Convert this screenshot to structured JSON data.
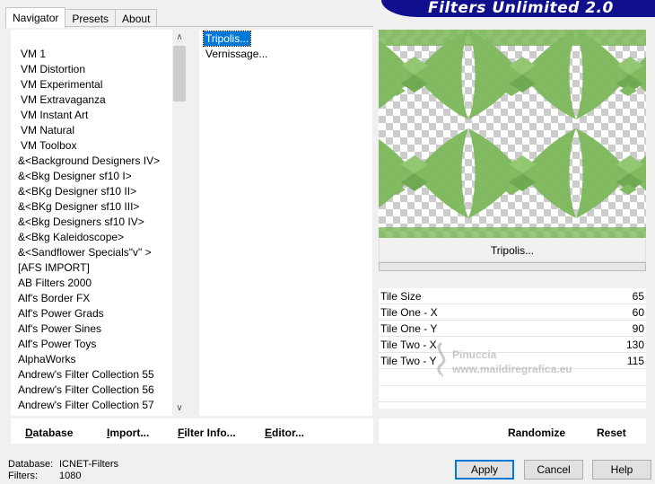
{
  "tabs": [
    "Navigator",
    "Presets",
    "About"
  ],
  "banner": "Filters Unlimited 2.0",
  "categories": [
    "VM 1",
    "VM Distortion",
    "VM Experimental",
    "VM Extravaganza",
    "VM Instant Art",
    "VM Natural",
    "VM Toolbox",
    "&<Background Designers IV>",
    "&<Bkg Designer sf10 I>",
    "&<BKg Designer sf10 II>",
    "&<BKg Designer sf10 III>",
    "&<Bkg Designers sf10 IV>",
    "&<Bkg Kaleidoscope>",
    "&<Sandflower Specials\"v\" >",
    "[AFS IMPORT]",
    "AB Filters 2000",
    "Alf's Border FX",
    "Alf's Power Grads",
    "Alf's Power Sines",
    "Alf's Power Toys",
    "AlphaWorks",
    "Andrew's Filter Collection 55",
    "Andrew's Filter Collection 56",
    "Andrew's Filter Collection 57"
  ],
  "filters": [
    "Tripolis...",
    "Vernissage..."
  ],
  "preview_label": "Tripolis...",
  "params": [
    {
      "name": "Tile Size",
      "value": "65"
    },
    {
      "name": "Tile One - X",
      "value": "60"
    },
    {
      "name": "Tile One - Y",
      "value": "90"
    },
    {
      "name": "Tile Two - X",
      "value": "130"
    },
    {
      "name": "Tile Two - Y",
      "value": "115"
    }
  ],
  "watermark": {
    "line1": "Pinuccia",
    "line2": "www.maildiregrafica.eu"
  },
  "toolbar": {
    "database": "Database",
    "import": "Import...",
    "filter_info": "Filter Info...",
    "editor": "Editor...",
    "randomize": "Randomize",
    "reset": "Reset"
  },
  "status": {
    "database_label": "Database:",
    "database_value": "ICNET-Filters",
    "filters_label": "Filters:",
    "filters_value": "1080"
  },
  "buttons": {
    "apply": "Apply",
    "cancel": "Cancel",
    "help": "Help"
  },
  "colors": {
    "banner": "#10108e",
    "selection": "#0078d7",
    "preview_green": "#7cb85a"
  }
}
